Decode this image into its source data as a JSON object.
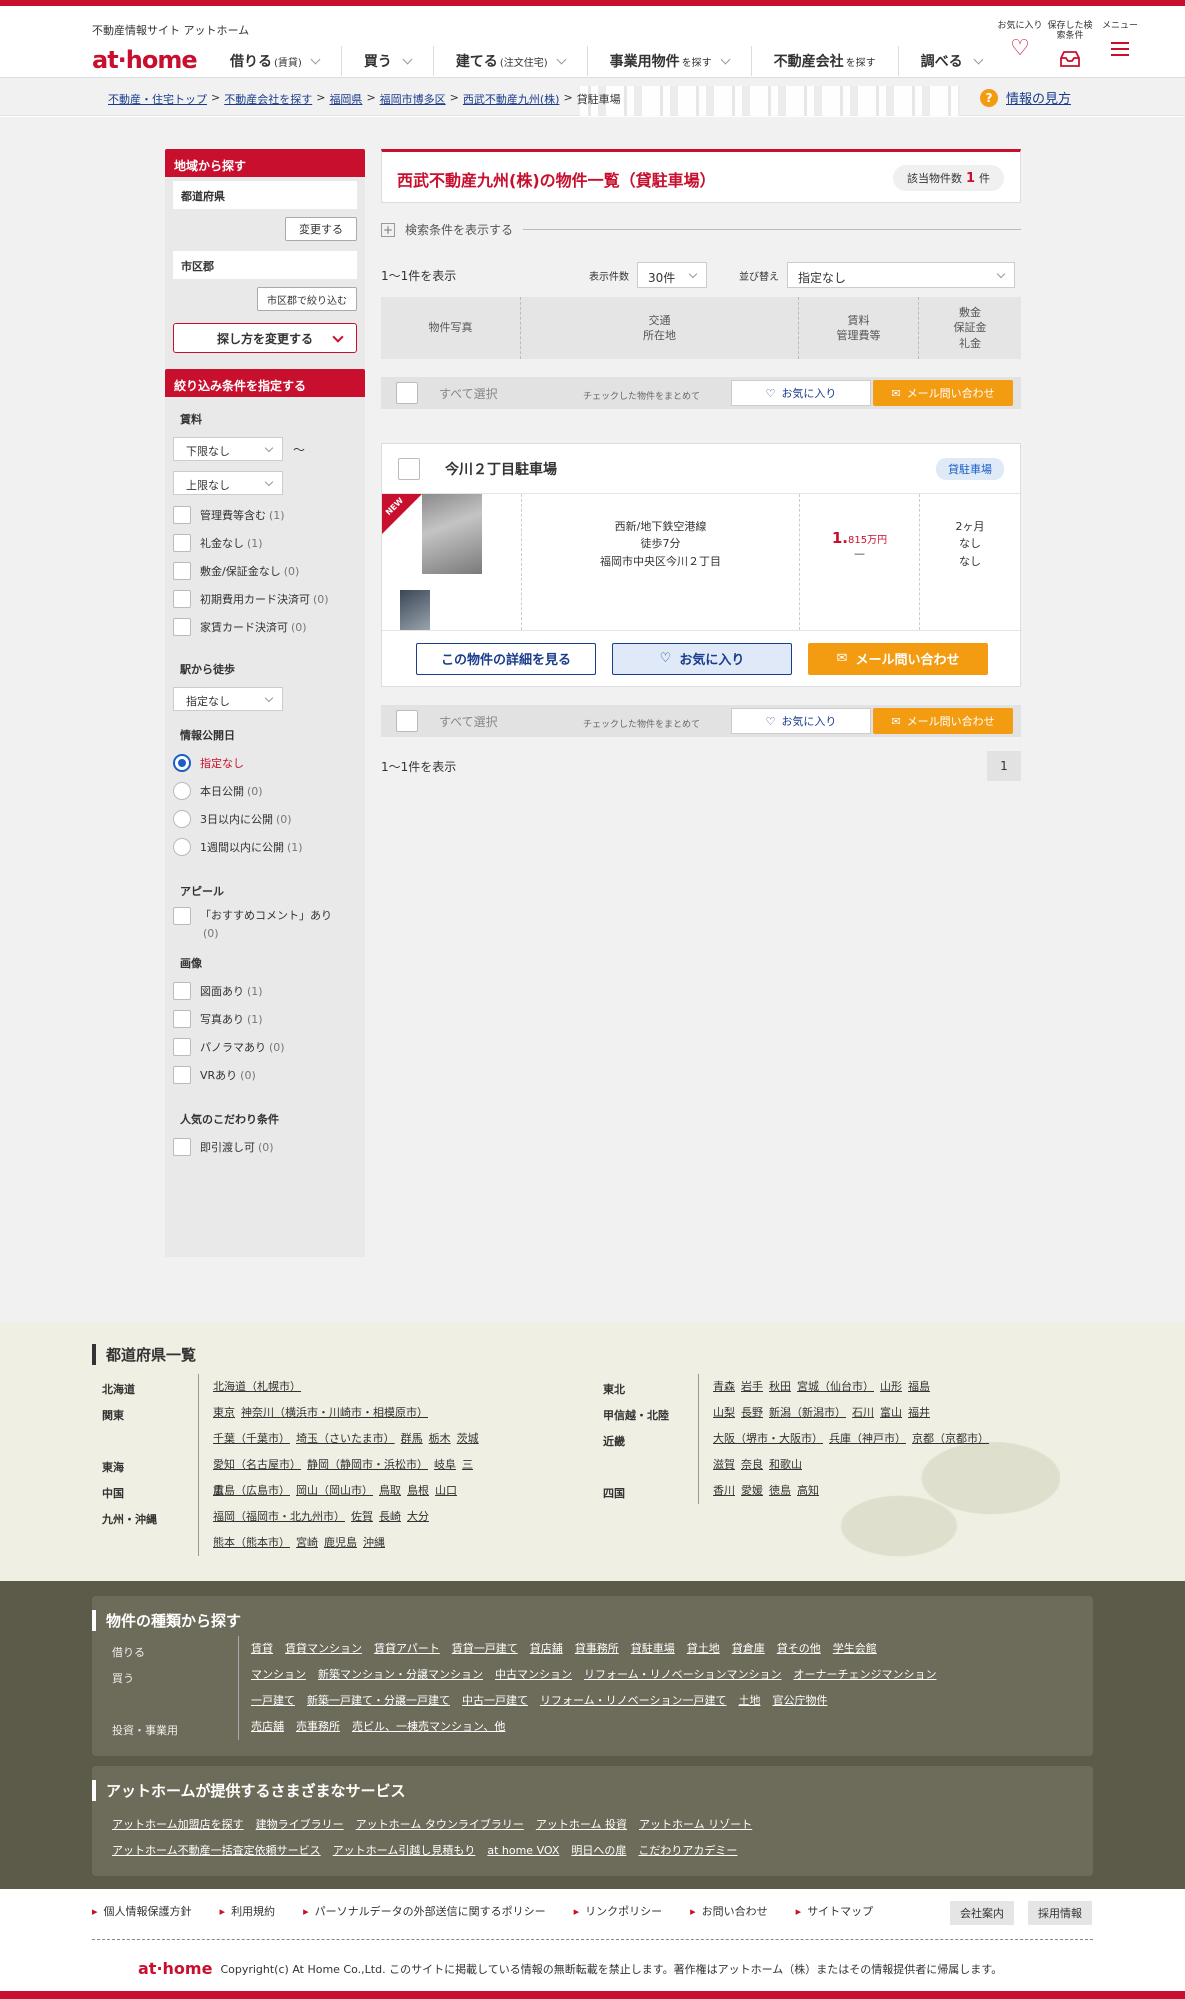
{
  "header": {
    "site_desc": "不動産情報サイト アットホーム",
    "logo_a": "at",
    "logo_b": "home",
    "nav": [
      {
        "label": "借りる",
        "sub": "(賃貸)"
      },
      {
        "label": "買う",
        "sub": ""
      },
      {
        "label": "建てる",
        "sub": "(注文住宅)"
      },
      {
        "label": "事業用物件",
        "sub": "を探す"
      },
      {
        "label": "不動産会社",
        "sub": "を探す"
      },
      {
        "label": "調べる",
        "sub": ""
      }
    ],
    "icons": [
      {
        "label": "お気に入り",
        "icon": "heart-icon"
      },
      {
        "label": "保存した検索条件",
        "icon": "inbox-icon"
      },
      {
        "label": "メニュー",
        "icon": "menu-icon"
      }
    ]
  },
  "breadcrumb": {
    "items": [
      "不動産・住宅トップ",
      "不動産会社を探す",
      "福岡県",
      "福岡市博多区",
      "西武不動産九州(株)"
    ],
    "current": "貸駐車場",
    "sep": ">",
    "howto_icon": "?",
    "howto": "情報の見方"
  },
  "sidebar": {
    "area_head": "地域から探す",
    "pref_label": "都道府県",
    "pref_btn": "変更する",
    "city_label": "市区郡",
    "city_btn": "市区郡で絞り込む",
    "change_btn": "探し方を変更する",
    "filter_head": "絞り込み条件を指定する",
    "rent_label": "賃料",
    "rent_min": "下限なし",
    "tilde": "〜",
    "rent_max": "上限なし",
    "rent_opts": [
      {
        "label": "管理費等含む",
        "count": "(1)"
      },
      {
        "label": "礼金なし",
        "count": "(1)"
      },
      {
        "label": "敷金/保証金なし",
        "count": "(0)"
      },
      {
        "label": "初期費用カード決済可",
        "count": "(0)"
      },
      {
        "label": "家賃カード決済可",
        "count": "(0)"
      }
    ],
    "walk_label": "駅から徒歩",
    "walk_val": "指定なし",
    "pub_label": "情報公開日",
    "pub_opts": [
      {
        "label": "指定なし",
        "count": ""
      },
      {
        "label": "本日公開",
        "count": "(0)"
      },
      {
        "label": "3日以内に公開",
        "count": "(0)"
      },
      {
        "label": "1週間以内に公開",
        "count": "(1)"
      }
    ],
    "appeal_label": "アピール",
    "appeal_opt": "「おすすめコメント」あり",
    "appeal_count": "(0)",
    "img_label": "画像",
    "img_opts": [
      {
        "label": "図面あり",
        "count": "(1)"
      },
      {
        "label": "写真あり",
        "count": "(1)"
      },
      {
        "label": "パノラマあり",
        "count": "(0)"
      },
      {
        "label": "VRあり",
        "count": "(0)"
      }
    ],
    "pop_label": "人気のこだわり条件",
    "pop_opt": "即引渡し可",
    "pop_count": "(0)"
  },
  "main": {
    "title": "西武不動産九州(株)の物件一覧（貸駐車場）",
    "count_label": "該当物件数",
    "count": "1",
    "count_unit": "件",
    "cond_icon": "+",
    "cond": "検索条件を表示する",
    "range": "1〜1件を表示",
    "per_label": "表示件数",
    "per_val": "30件",
    "sort_label": "並び替え",
    "sort_val": "指定なし",
    "cols": [
      "物件写真",
      "交通",
      "所在地",
      "賃料",
      "管理費等",
      "敷金",
      "保証金",
      "礼金"
    ],
    "selall": "すべて選択",
    "sel_note": "チェックした物件をまとめて",
    "fav": "お気に入り",
    "mail": "メール問い合わせ",
    "page": "1"
  },
  "card": {
    "name": "今川２丁目駐車場",
    "tag": "貸駐車場",
    "new": "NEW",
    "line": "西新/地下鉄空港線",
    "walk": "徒歩7分",
    "address": "福岡市中央区今川２丁目",
    "rent_num": "1.",
    "rent_rest": "815万円",
    "fee": "—",
    "deposit": "2ヶ月",
    "guarantee": "なし",
    "key": "なし",
    "detail_btn": "この物件の詳細を見る",
    "fav_btn": "お気に入り",
    "mail_btn": "メール問い合わせ"
  },
  "pref": {
    "title": "都道府県一覧",
    "left": [
      {
        "region": "北海道",
        "links": [
          "北海道（札幌市）"
        ]
      },
      {
        "region": "関東",
        "links": [
          "東京",
          "神奈川（横浜市・川崎市・相模原市）",
          "千葉（千葉市）",
          "埼玉（さいたま市）",
          "群馬",
          "栃木",
          "茨城"
        ]
      },
      {
        "region": "東海",
        "links": [
          "愛知（名古屋市）",
          "静岡（静岡市・浜松市）",
          "岐阜",
          "三重"
        ]
      },
      {
        "region": "中国",
        "links": [
          "広島（広島市）",
          "岡山（岡山市）",
          "鳥取",
          "島根",
          "山口"
        ]
      },
      {
        "region": "九州・沖縄",
        "links": [
          "福岡（福岡市・北九州市）",
          "佐賀",
          "長崎",
          "大分",
          "熊本（熊本市）",
          "宮崎",
          "鹿児島",
          "沖縄"
        ]
      }
    ],
    "right": [
      {
        "region": "東北",
        "links": [
          "青森",
          "岩手",
          "秋田",
          "宮城（仙台市）",
          "山形",
          "福島"
        ]
      },
      {
        "region": "甲信越・北陸",
        "links": [
          "山梨",
          "長野",
          "新潟（新潟市）",
          "石川",
          "富山",
          "福井"
        ]
      },
      {
        "region": "近畿",
        "links": [
          "大阪（堺市・大阪市）",
          "兵庫（神戸市）",
          "京都（京都市）",
          "滋賀",
          "奈良",
          "和歌山"
        ]
      },
      {
        "region": "四国",
        "links": [
          "香川",
          "愛媛",
          "徳島",
          "高知"
        ]
      }
    ]
  },
  "types": {
    "title": "物件の種類から探す",
    "cats": [
      {
        "label": "借りる",
        "links": [
          "賃貸",
          "賃貸マンション",
          "賃貸アパート",
          "賃貸一戸建て",
          "貸店舗",
          "貸事務所",
          "貸駐車場",
          "貸土地",
          "貸倉庫",
          "貸その他",
          "学生会館"
        ]
      },
      {
        "label": "買う",
        "links": [
          "マンション",
          "新築マンション・分譲マンション",
          "中古マンション",
          "リフォーム・リノベーションマンション",
          "オーナーチェンジマンション",
          "一戸建て",
          "新築一戸建て・分譲一戸建て",
          "中古一戸建て",
          "リフォーム・リノベーション一戸建て",
          "土地",
          "官公庁物件"
        ]
      },
      {
        "label": "投資・事業用",
        "links": [
          "売店舗",
          "売事務所",
          "売ビル、一棟売マンション、他"
        ]
      }
    ],
    "svc_title": "アットホームが提供するさまざまなサービス",
    "services": [
      "アットホーム加盟店を探す",
      "建物ライブラリー",
      "アットホーム タウンライブラリー",
      "アットホーム 投資",
      "アットホーム リゾート",
      "アットホーム不動産一括査定依頼サービス",
      "アットホーム引越し見積もり",
      "at home VOX",
      "明日への扉",
      "こだわりアカデミー"
    ]
  },
  "footer": {
    "links": [
      "個人情報保護方針",
      "利用規約",
      "パーソナルデータの外部送信に関するポリシー",
      "リンクポリシー",
      "お問い合わせ",
      "サイトマップ"
    ],
    "company": "会社案内",
    "recruit": "採用情報",
    "logo": "at·home",
    "copy": "Copyright(c) At Home Co.,Ltd. このサイトに掲載している情報の無断転載を禁止します。著作権はアットホーム（株）またはその情報提供者に帰属します。"
  }
}
